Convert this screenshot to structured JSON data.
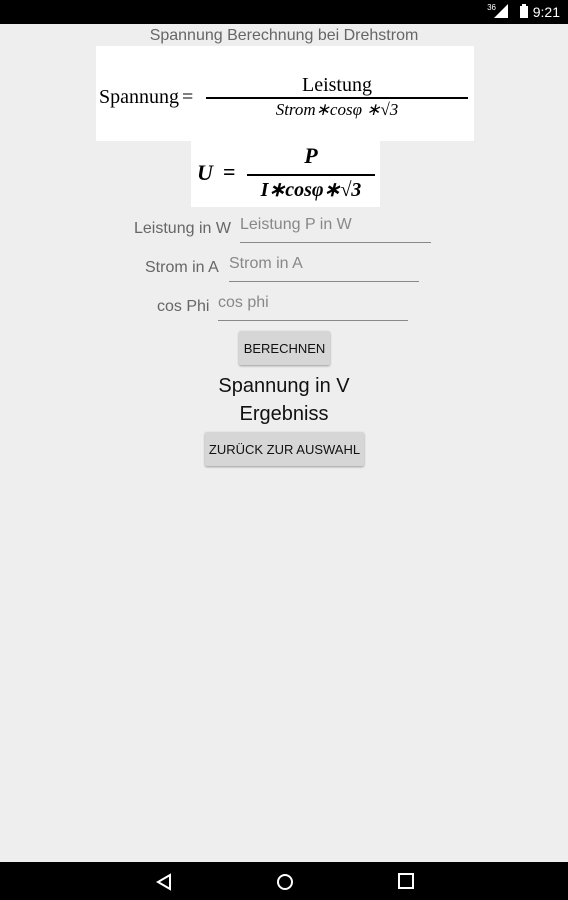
{
  "status": {
    "network_label": "36",
    "time": "9:21"
  },
  "title": "Spannung Berechnung bei Drehstrom",
  "formula_words": {
    "lhs": "Spannung",
    "eq": "=",
    "numerator": "Leistung",
    "denominator": "Strom∗cosφ ∗√3"
  },
  "formula_symbols": {
    "lhs": "U",
    "eq": "=",
    "numerator": "P",
    "denominator": "I∗cosφ∗√3"
  },
  "fields": {
    "power": {
      "label": "Leistung in W",
      "placeholder": "Leistung P in W",
      "value": ""
    },
    "current": {
      "label": "Strom in A",
      "placeholder": "Strom in A",
      "value": ""
    },
    "cosphi": {
      "label": "cos Phi",
      "placeholder": "cos phi",
      "value": ""
    }
  },
  "buttons": {
    "calculate": "BERECHNEN",
    "back": "ZURÜCK ZUR AUSWAHL"
  },
  "result": {
    "label": "Spannung in V",
    "value": "Ergebniss"
  },
  "nav": {
    "back": "back-icon",
    "home": "home-icon",
    "recents": "recents-icon"
  }
}
